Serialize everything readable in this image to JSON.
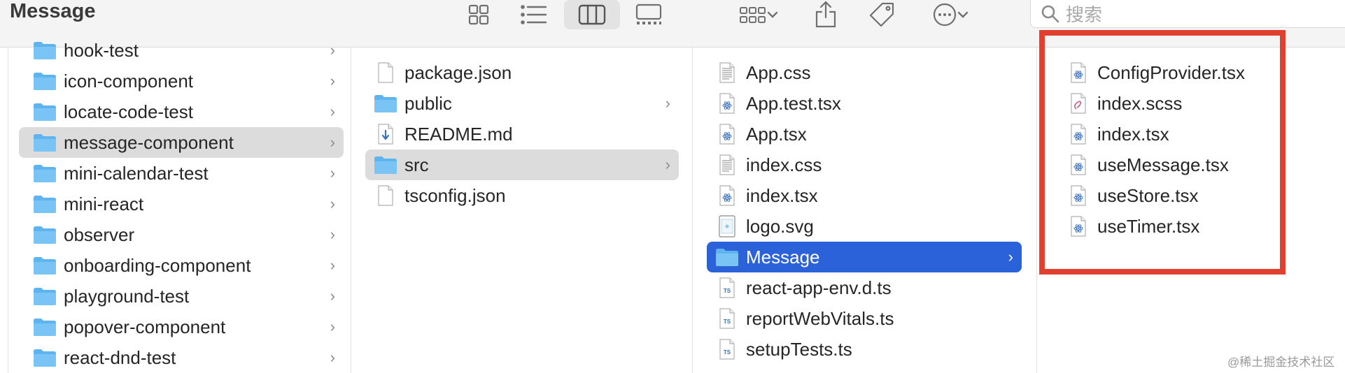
{
  "window": {
    "title": "Message"
  },
  "search": {
    "placeholder": "搜索"
  },
  "columns": {
    "projects": [
      {
        "name": "hook-test",
        "type": "folder"
      },
      {
        "name": "icon-component",
        "type": "folder"
      },
      {
        "name": "locate-code-test",
        "type": "folder"
      },
      {
        "name": "message-component",
        "type": "folder",
        "selected": true
      },
      {
        "name": "mini-calendar-test",
        "type": "folder"
      },
      {
        "name": "mini-react",
        "type": "folder"
      },
      {
        "name": "observer",
        "type": "folder"
      },
      {
        "name": "onboarding-component",
        "type": "folder"
      },
      {
        "name": "playground-test",
        "type": "folder"
      },
      {
        "name": "popover-component",
        "type": "folder"
      },
      {
        "name": "react-dnd-test",
        "type": "folder"
      }
    ],
    "project_root": [
      {
        "name": "package.json",
        "type": "blank"
      },
      {
        "name": "public",
        "type": "folder"
      },
      {
        "name": "README.md",
        "type": "markdown"
      },
      {
        "name": "src",
        "type": "folder",
        "selected": true
      },
      {
        "name": "tsconfig.json",
        "type": "blank"
      }
    ],
    "src": [
      {
        "name": "App.css",
        "type": "text"
      },
      {
        "name": "App.test.tsx",
        "type": "react"
      },
      {
        "name": "App.tsx",
        "type": "react"
      },
      {
        "name": "index.css",
        "type": "text"
      },
      {
        "name": "index.tsx",
        "type": "react"
      },
      {
        "name": "logo.svg",
        "type": "image"
      },
      {
        "name": "Message",
        "type": "folder",
        "selected": true
      },
      {
        "name": "react-app-env.d.ts",
        "type": "ts"
      },
      {
        "name": "reportWebVitals.ts",
        "type": "ts"
      },
      {
        "name": "setupTests.ts",
        "type": "ts"
      }
    ],
    "message": [
      {
        "name": "ConfigProvider.tsx",
        "type": "react"
      },
      {
        "name": "index.scss",
        "type": "sass"
      },
      {
        "name": "index.tsx",
        "type": "react"
      },
      {
        "name": "useMessage.tsx",
        "type": "react"
      },
      {
        "name": "useStore.tsx",
        "type": "react"
      },
      {
        "name": "useTimer.tsx",
        "type": "react"
      }
    ]
  },
  "icons": {
    "toolbar": [
      "icon-view-icon",
      "list-view-icon",
      "column-view-icon",
      "gallery-view-icon",
      "group-icon",
      "share-icon",
      "tag-icon",
      "more-icon",
      "search-icon"
    ],
    "chevron": "›"
  },
  "colors": {
    "folder": "#5eb4ef",
    "selection_blue": "#2b62d9",
    "selection_gray": "#dcdcdc",
    "highlight_box": "#e2402f"
  },
  "watermark": "@稀土掘金技术社区"
}
